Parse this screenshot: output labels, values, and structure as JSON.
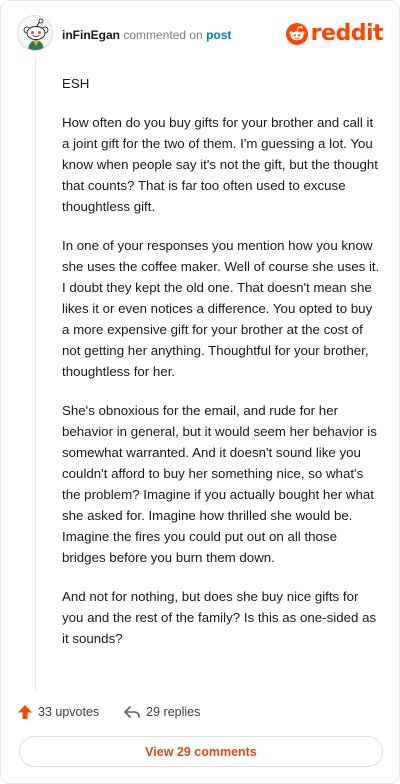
{
  "comment": {
    "username": "inFinEgan",
    "action_text": "commented on",
    "target_link": "post",
    "paragraphs": [
      "ESH",
      "How often do you buy gifts for your brother and call it a joint gift for the two of them. I'm guessing a lot. You know when people say it's not the gift, but the thought that counts? That is far too often used to excuse thoughtless gift.",
      "In one of your responses you mention how you know she uses the coffee maker. Well of course she uses it. I doubt they kept the old one. That doesn't mean she likes it or even notices a difference. You opted to buy a more expensive gift for your brother at the cost of not getting her anything. Thoughtful for your brother, thoughtless for her.",
      "She's obnoxious for the email, and rude for her behavior in general, but it would seem her behavior is somewhat warranted. And it doesn't sound like you couldn't afford to buy her something nice, so what's the problem? Imagine if you actually bought her what she asked for. Imagine how thrilled she would be. Imagine the fires you could put out on all those bridges before you burn them down.",
      "And not for nothing, but does she buy nice gifts for you and the rest of the family? Is this as one-sided as it sounds?"
    ]
  },
  "brand": {
    "wordmark": "reddit",
    "color": "#ff4500"
  },
  "actions": {
    "upvotes": "33 upvotes",
    "replies": "29 replies"
  },
  "footer": {
    "view_comments": "View 29 comments"
  },
  "colors": {
    "accent": "#ff4500",
    "link": "#0079d3",
    "button_text": "#e04a15"
  },
  "icons": {
    "avatar": "snoo-avatar-icon",
    "logo": "reddit-snoo-icon",
    "upvote": "upvote-arrow-icon",
    "reply": "reply-arrow-icon"
  }
}
